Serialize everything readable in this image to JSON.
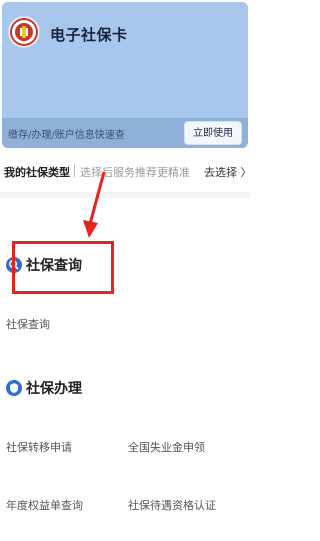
{
  "card": {
    "title": "电子社保卡",
    "description": "缴存/办理/账户信息快速查",
    "use_button": "立即使用",
    "logo_icon": "social-security-logo-icon"
  },
  "type_row": {
    "label": "我的社保类型",
    "hint": "选择后服务推荐更精准",
    "link": "去选择 〉"
  },
  "sections": [
    {
      "title": "社保查询",
      "icon": "search-icon",
      "items": [
        "社保查询"
      ]
    },
    {
      "title": "社保办理",
      "icon": "shield-icon",
      "items": [
        "社保转移申请",
        "全国失业金申领",
        "年度权益单查询",
        "社保待遇资格认证"
      ]
    }
  ],
  "annotation": {
    "color": "#e8221c"
  }
}
